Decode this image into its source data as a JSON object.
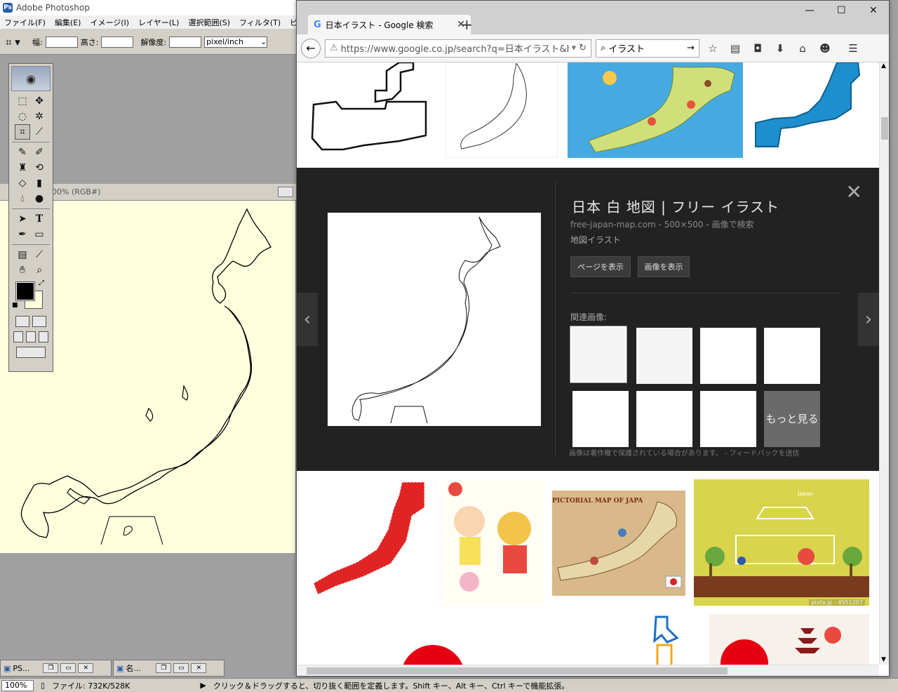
{
  "photoshop": {
    "title": "Adobe Photoshop",
    "menu": [
      "ファイル(F)",
      "編集(E)",
      "イメージ(I)",
      "レイヤー(L)",
      "選択範囲(S)",
      "フィルタ(T)",
      "ビュー(V)"
    ],
    "options": {
      "width_label": "幅:",
      "height_label": "高さ:",
      "resolution_label": "解像度:",
      "unit": "pixel/inch"
    },
    "doc_title": "00% (RGB#)",
    "colors": {
      "foreground": "#000000",
      "background": "#ffffe0",
      "canvas": "#ffffde"
    },
    "taskbar": [
      {
        "label": "PS..."
      },
      {
        "label": "名..."
      }
    ],
    "status": {
      "zoom": "100%",
      "file": "ファイル: 732K/528K",
      "hint": "クリック＆ドラッグすると、切り抜く範囲を定義します。Shift キー、Alt キー、Ctrl キーで機能拡張。"
    }
  },
  "browser": {
    "tab_title": "日本イラスト - Google 検索",
    "url": "https://www.google.co.jp/search?q=日本イラスト&hl=ja",
    "search": "イラスト",
    "preview": {
      "title": "日本 白 地図 | フリー イラスト",
      "source": "free-japan-map.com - 500×500 - 画像で検索",
      "desc": "地図イラスト",
      "view_page": "ページを表示",
      "view_image": "画像を表示",
      "related": "関連画像:",
      "more": "もっと見る",
      "note": "画像は著作権で保護されている場合があります。 - フィードバックを送信"
    },
    "thumbs": {
      "pictorial": "PICTORIAL MAP OF JAPAN",
      "welcome": "Japan",
      "pixta": "pixta.jp - 4551207"
    }
  }
}
